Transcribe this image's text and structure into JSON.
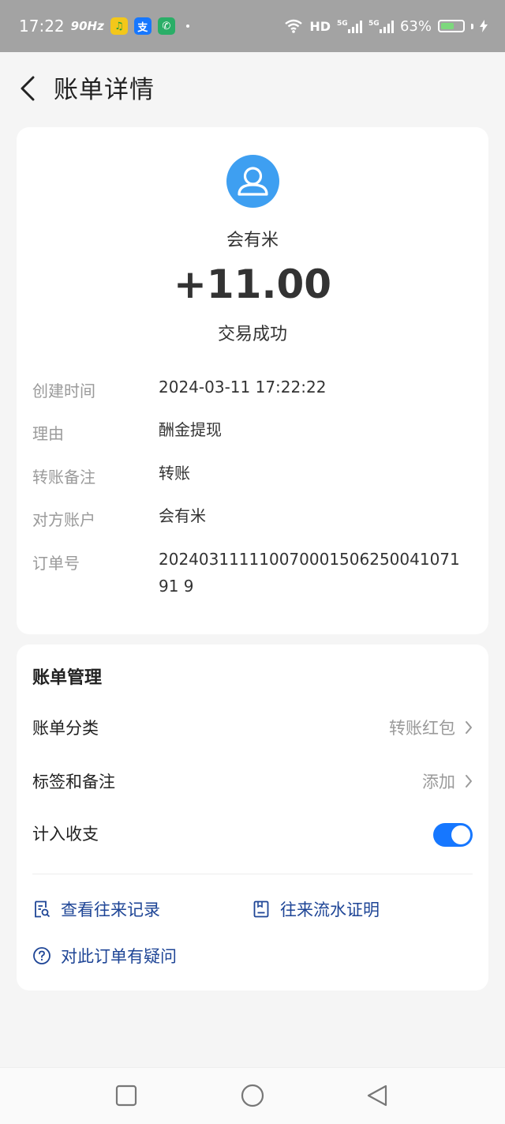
{
  "status_bar": {
    "time": "17:22",
    "refresh_rate": "90Hz",
    "network": "HD",
    "battery_percent": "63%",
    "battery_level": 0.63,
    "icons": [
      "qq-music-icon",
      "alipay-icon",
      "wechat-icon",
      "wifi-icon",
      "signal-5g-icon",
      "signal-5g-icon",
      "battery-icon",
      "charging-icon"
    ]
  },
  "header": {
    "title": "账单详情",
    "back_icon": "chevron-left-icon"
  },
  "summary": {
    "payee_name": "会有米",
    "amount": "+11.00",
    "status": "交易成功",
    "avatar_icon": "user-avatar-icon",
    "avatar_color": "#3e9ff1"
  },
  "details": [
    {
      "label": "创建时间",
      "value": "2024-03-11 17:22:22"
    },
    {
      "label": "理由",
      "value": "酬金提现"
    },
    {
      "label": "转账备注",
      "value": "转账"
    },
    {
      "label": "对方账户",
      "value": "会有米"
    },
    {
      "label": "订单号",
      "value": "20240311111007000150625004107191 9"
    }
  ],
  "management": {
    "title": "账单管理",
    "category_label": "账单分类",
    "category_value": "转账红包",
    "tags_label": "标签和备注",
    "tags_value": "添加",
    "count_label": "计入收支",
    "count_enabled": true,
    "accent_color": "#1677ff"
  },
  "links": {
    "history": "查看往来记录",
    "proof": "往来流水证明",
    "question": "对此订单有疑问"
  },
  "navbar": {
    "icons": [
      "recent-apps-icon",
      "home-icon",
      "back-icon"
    ]
  }
}
